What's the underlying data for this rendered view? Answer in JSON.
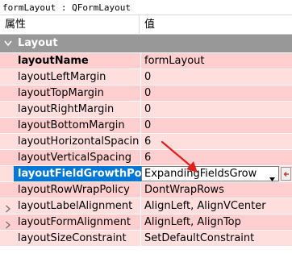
{
  "window": {
    "title": "formLayout : QFormLayout"
  },
  "header": {
    "property_col": "属性",
    "value_col": "值"
  },
  "group": {
    "label": "Layout"
  },
  "rows": [
    {
      "name": "layoutName",
      "value": "formLayout"
    },
    {
      "name": "layoutLeftMargin",
      "value": "0"
    },
    {
      "name": "layoutTopMargin",
      "value": "0"
    },
    {
      "name": "layoutRightMargin",
      "value": "0"
    },
    {
      "name": "layoutBottomMargin",
      "value": "0"
    },
    {
      "name": "layoutHorizontalSpacing",
      "value": "6"
    },
    {
      "name": "layoutVerticalSpacing",
      "value": "6"
    },
    {
      "name": "layoutFieldGrowthPol...",
      "value": "ExpandingFieldsGrow"
    },
    {
      "name": "layoutRowWrapPolicy",
      "value": "DontWrapRows"
    },
    {
      "name": "layoutLabelAlignment",
      "value": "AlignLeft, AlignVCenter"
    },
    {
      "name": "layoutFormAlignment",
      "value": "AlignLeft, AlignTop"
    },
    {
      "name": "layoutSizeConstraint",
      "value": "SetDefaultConstraint"
    }
  ],
  "icons": {
    "group_toggle": "chevron-down-icon",
    "expander": "chevron-right-icon",
    "combo_arrow": "dropdown-arrow-icon",
    "reset": "reset-icon",
    "annotation": "red-arrow-icon"
  },
  "colors": {
    "selection": "#0078d7",
    "row_pink_dark": "#ffcfcf",
    "row_pink_light": "#ffdede",
    "group_header": "#989898",
    "annotation_arrow": "#e0201a"
  }
}
